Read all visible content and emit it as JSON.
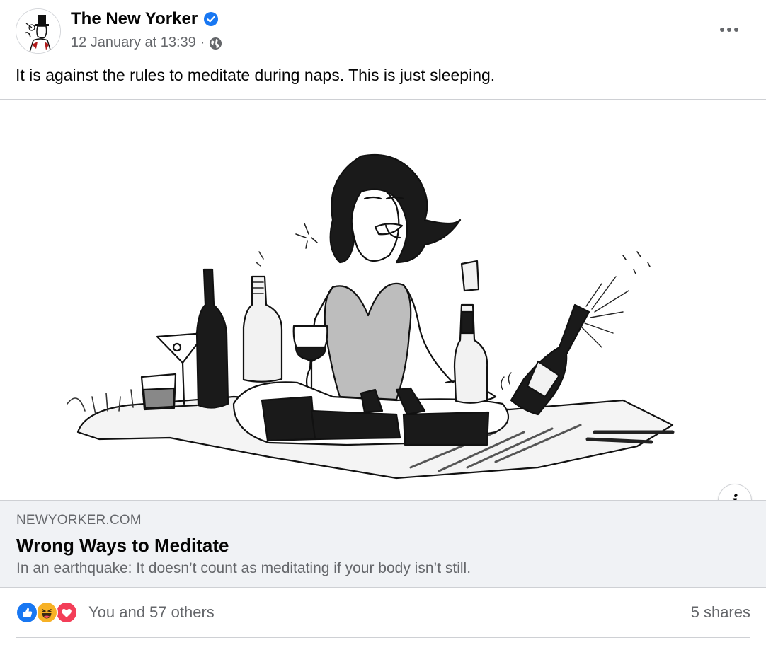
{
  "post": {
    "page_name": "The New Yorker",
    "timestamp": "12 January at 13:39",
    "separator": "·",
    "audience_icon": "globe-icon",
    "verified_icon": "verified-badge-icon",
    "more_icon": "more-options-icon",
    "text": "It is against the rules to meditate during naps. This is just sleeping."
  },
  "media": {
    "info_label": "i"
  },
  "link_preview": {
    "domain": "NEWYORKER.COM",
    "title": "Wrong Ways to Meditate",
    "description": "In an earthquake: It doesn’t count as meditating if your body isn’t still."
  },
  "engagement": {
    "reaction_icons": [
      "like-icon",
      "haha-icon",
      "love-icon"
    ],
    "reaction_text": "You and 57 others",
    "shares_text": "5 shares"
  },
  "colors": {
    "brand_blue": "#1877f2",
    "secondary_text": "#65676b",
    "link_card_bg": "#f0f2f5"
  }
}
